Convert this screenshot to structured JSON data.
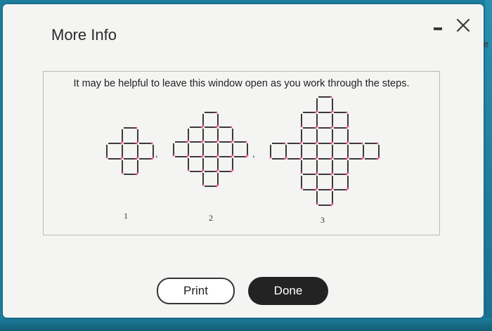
{
  "window": {
    "title": "More Info",
    "minimize_icon": "minimize-icon",
    "close_icon": "close-icon"
  },
  "panel": {
    "instruction": "It may be helpful to leave this window open as you work through the steps.",
    "figure_labels": [
      "1",
      "2",
      "3"
    ],
    "figure_separators": [
      ",",
      ","
    ]
  },
  "buttons": {
    "print_label": "Print",
    "done_label": "Done"
  },
  "colors": {
    "matchstick": "#3a3a3a",
    "match_head": "#d4488a",
    "done_bg": "#232323",
    "backdrop": "#1e7f9f"
  }
}
